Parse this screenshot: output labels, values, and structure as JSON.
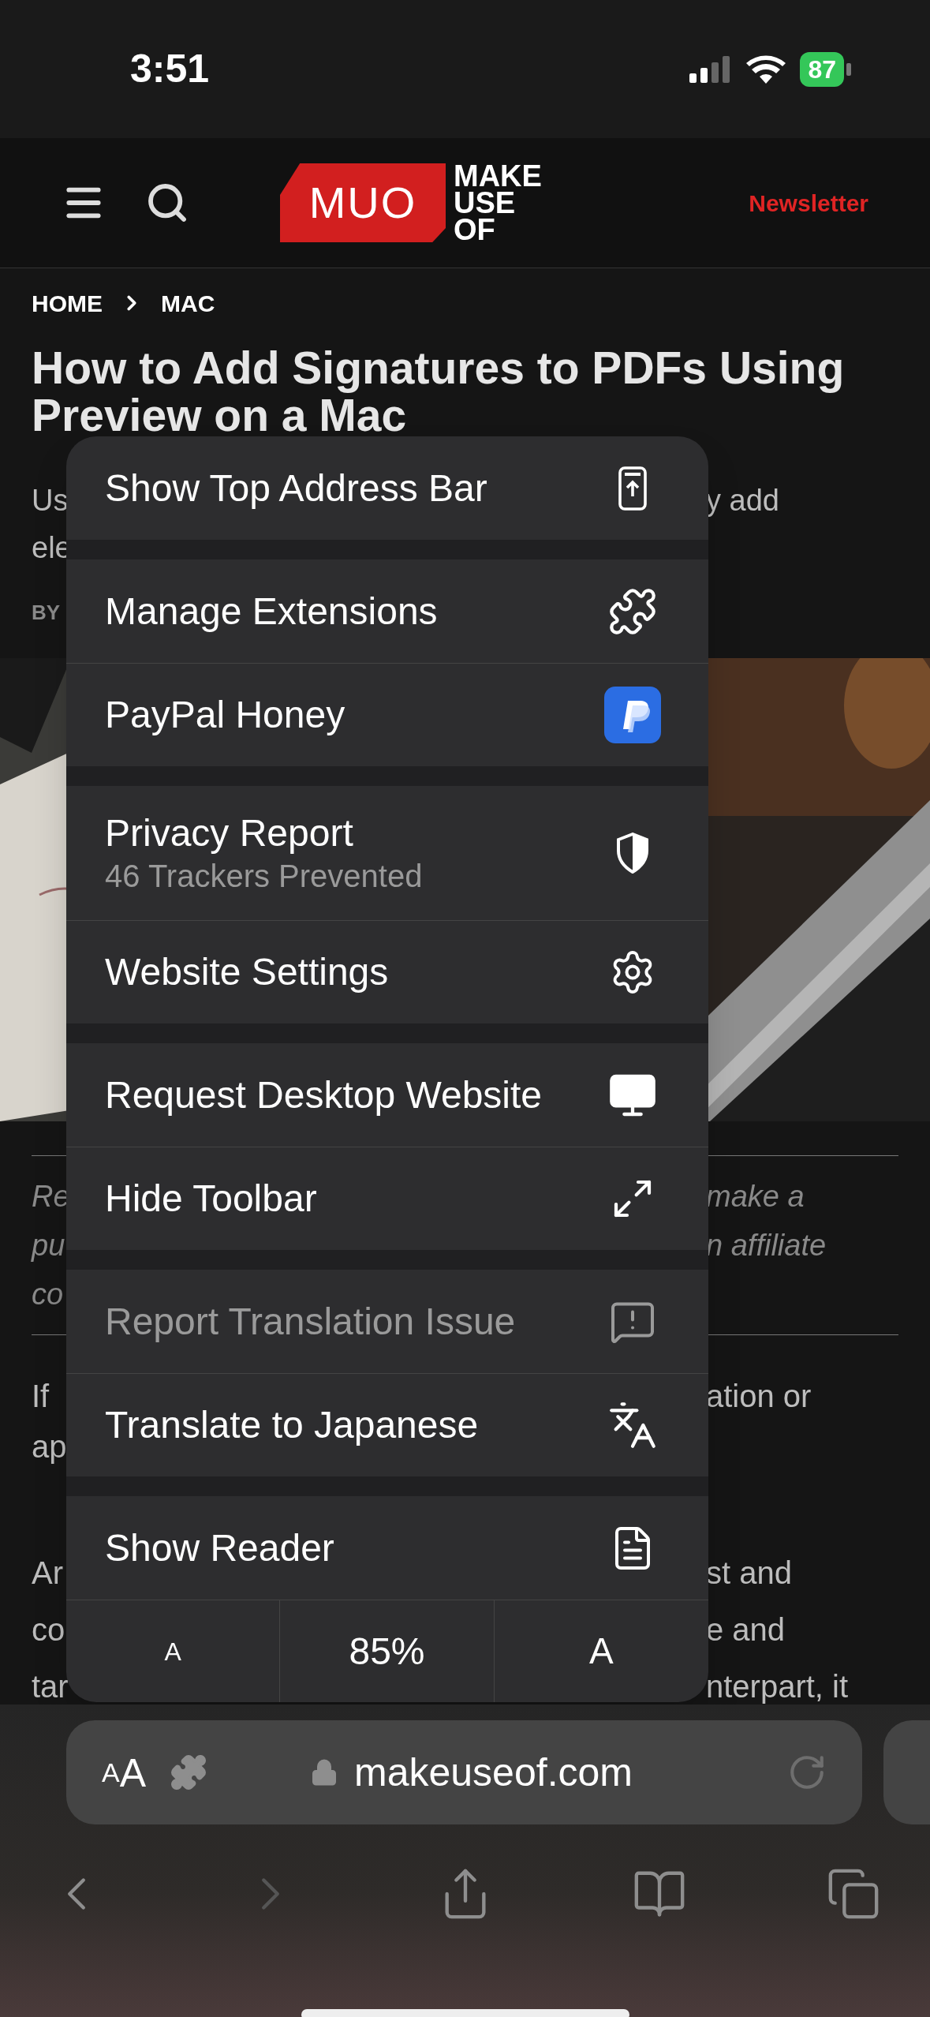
{
  "status_bar": {
    "time": "3:51",
    "battery": "87"
  },
  "site_header": {
    "logo_mark": "MUO",
    "logo_text": [
      "MAKE",
      "USE",
      "OF"
    ],
    "newsletter": "Newsletter"
  },
  "breadcrumb": [
    "HOME",
    "MAC"
  ],
  "article": {
    "title": [
      "How to Add Signatures to PDFs Using",
      "Preview on a Mac"
    ],
    "subtitle_lines": [
      {
        "left": "Us",
        "right": "y add"
      },
      {
        "left": "ele"
      }
    ],
    "byline": "BY",
    "disclosure_lines": [
      {
        "left": "Re",
        "right": "make a"
      },
      {
        "left": "pu",
        "right": "n affiliate"
      },
      {
        "left": "co"
      }
    ],
    "paragraphs": [
      [
        {
          "left": "If",
          "right": "ation or"
        },
        {
          "left": "ap"
        }
      ],
      [
        {
          "left": "Ar",
          "right": "st and"
        },
        {
          "left": "co",
          "right": "e and"
        },
        {
          "left": "tar",
          "right": "nterpart, it"
        }
      ]
    ]
  },
  "menu": {
    "groups": [
      {
        "items": [
          {
            "kind": "action",
            "label": "Show Top Address Bar",
            "disabled": false
          }
        ]
      },
      {
        "items": [
          {
            "kind": "action",
            "label": "Manage Extensions",
            "disabled": false
          },
          {
            "kind": "action",
            "label": "PayPal Honey",
            "disabled": false
          }
        ]
      },
      {
        "items": [
          {
            "kind": "action",
            "label": "Privacy Report",
            "detail": "46 Trackers Prevented",
            "disabled": false
          },
          {
            "kind": "action",
            "label": "Website Settings",
            "disabled": false
          }
        ]
      },
      {
        "items": [
          {
            "kind": "action",
            "label": "Request Desktop Website",
            "disabled": false
          },
          {
            "kind": "action",
            "label": "Hide Toolbar",
            "disabled": false
          }
        ]
      },
      {
        "items": [
          {
            "kind": "action",
            "label": "Report Translation Issue",
            "disabled": true
          },
          {
            "kind": "action",
            "label": "Translate to Japanese",
            "disabled": false
          }
        ]
      },
      {
        "items": [
          {
            "kind": "action",
            "label": "Show Reader",
            "disabled": false
          },
          {
            "kind": "zoom",
            "smaller": "A",
            "reading": "85%",
            "larger": "A",
            "disabled": false
          }
        ]
      }
    ]
  },
  "address_bar": {
    "text_size": [
      "A",
      "A"
    ],
    "url": "makeuseof.com"
  },
  "toolbar": {
    "back_disabled": false,
    "forward_disabled": true
  }
}
